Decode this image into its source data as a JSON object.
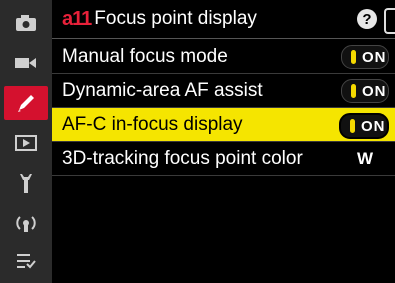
{
  "header": {
    "code": "a11",
    "title": "Focus point display",
    "help_label": "?",
    "edge_label": "▶"
  },
  "sidebar": {
    "items": [
      {
        "name": "camera-icon"
      },
      {
        "name": "movie-icon"
      },
      {
        "name": "pencil-icon",
        "active": true
      },
      {
        "name": "playback-icon"
      },
      {
        "name": "wrench-icon"
      },
      {
        "name": "network-icon"
      },
      {
        "name": "my-menu-icon"
      }
    ],
    "active_color": "#d4112e"
  },
  "rows": [
    {
      "label": "Manual focus mode",
      "value": "ON"
    },
    {
      "label": "Dynamic-area AF assist",
      "value": "ON"
    },
    {
      "label": "AF-C in-focus display",
      "value": "ON"
    },
    {
      "label": "3D-tracking focus point color",
      "value": "W"
    }
  ],
  "highlight_color": "#f5e500"
}
